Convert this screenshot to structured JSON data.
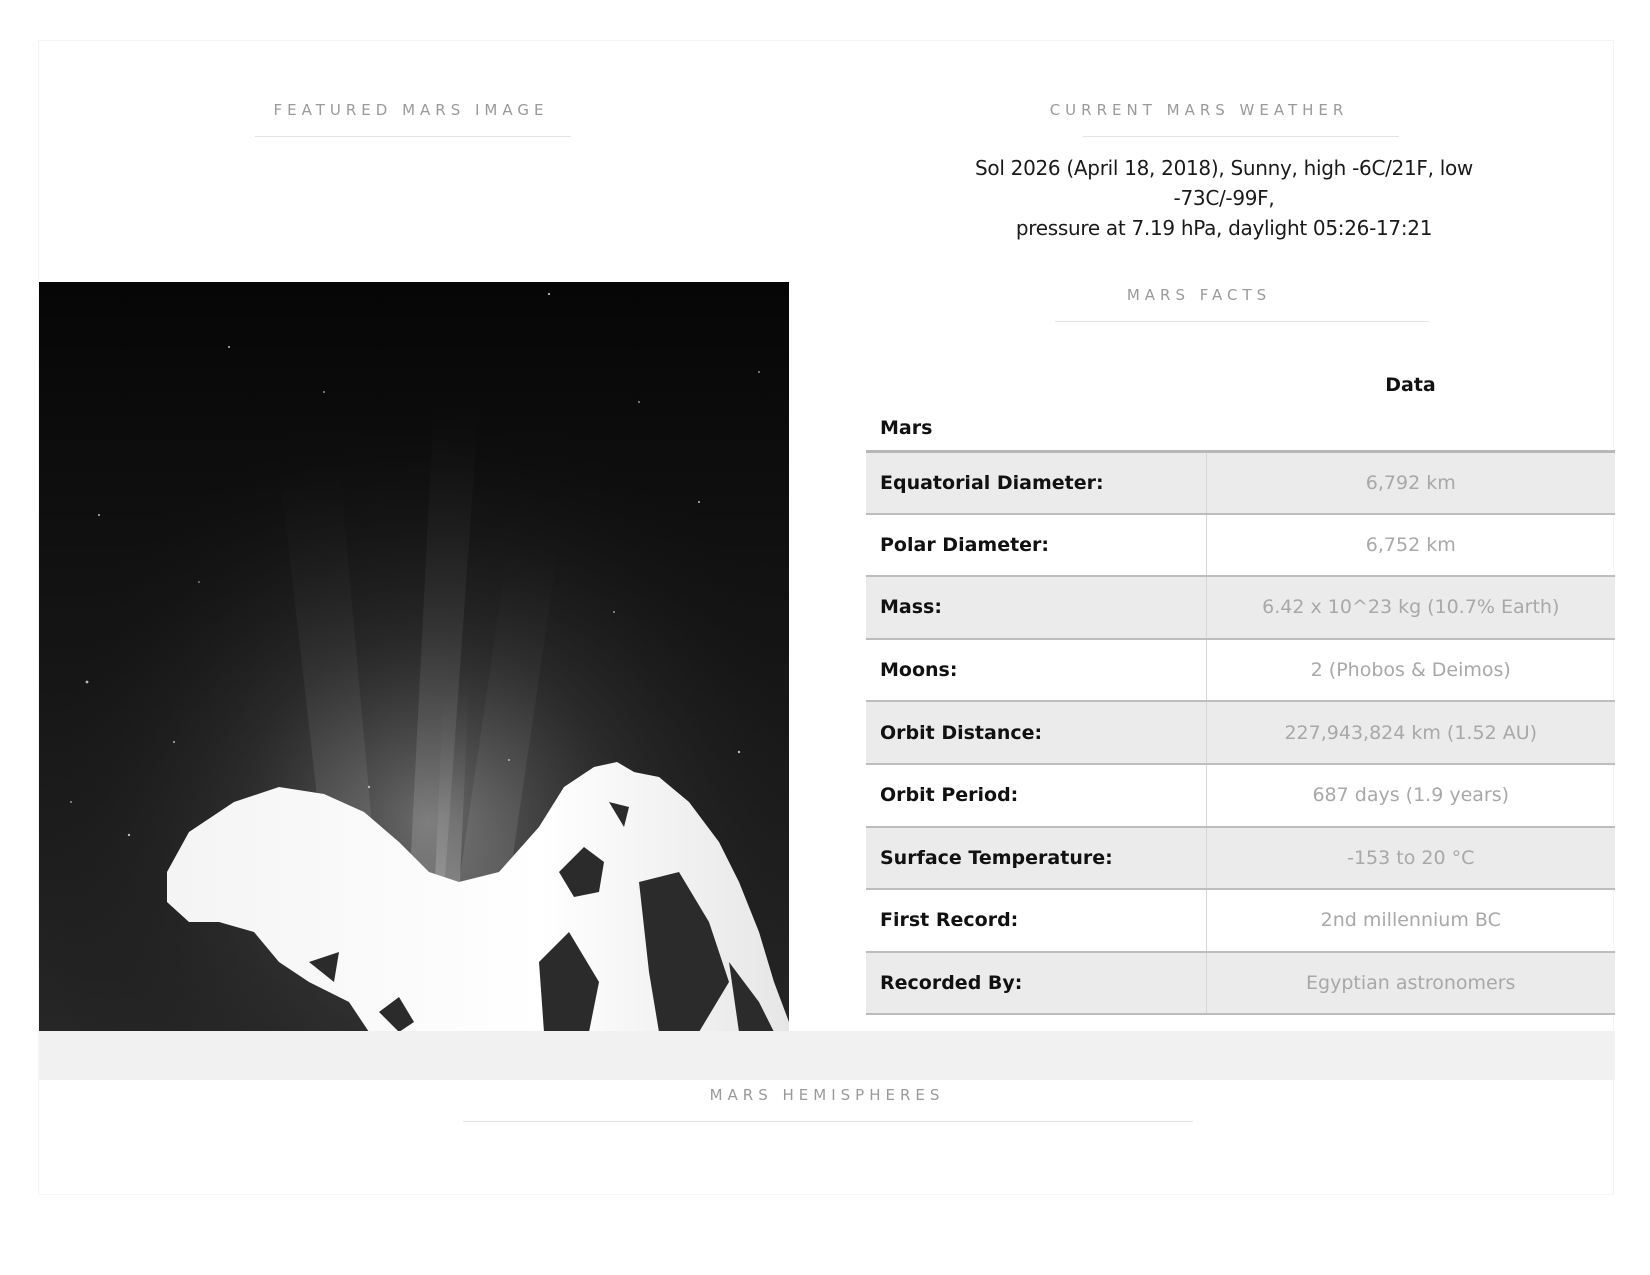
{
  "featured": {
    "title": "FEATURED MARS IMAGE"
  },
  "weather": {
    "title": "CURRENT MARS WEATHER",
    "line1": "Sol 2026 (April 18, 2018), Sunny, high -6C/21F, low -73C/-99F,",
    "line2": "pressure at 7.19 hPa, daylight 05:26-17:21"
  },
  "facts": {
    "title": "MARS FACTS",
    "column_header": "Data",
    "row_header": "Mars",
    "rows": [
      {
        "label": "Equatorial Diameter:",
        "value": "6,792 km"
      },
      {
        "label": "Polar Diameter:",
        "value": "6,752 km"
      },
      {
        "label": "Mass:",
        "value": "6.42 x 10^23 kg (10.7% Earth)"
      },
      {
        "label": "Moons:",
        "value": "2 (Phobos & Deimos)"
      },
      {
        "label": "Orbit Distance:",
        "value": "227,943,824 km (1.52 AU)"
      },
      {
        "label": "Orbit Period:",
        "value": "687 days (1.9 years)"
      },
      {
        "label": "Surface Temperature:",
        "value": "-153 to 20 °C"
      },
      {
        "label": "First Record:",
        "value": "2nd millennium BC"
      },
      {
        "label": "Recorded By:",
        "value": "Egyptian astronomers"
      }
    ]
  },
  "hemispheres": {
    "title": "MARS HEMISPHERES"
  }
}
